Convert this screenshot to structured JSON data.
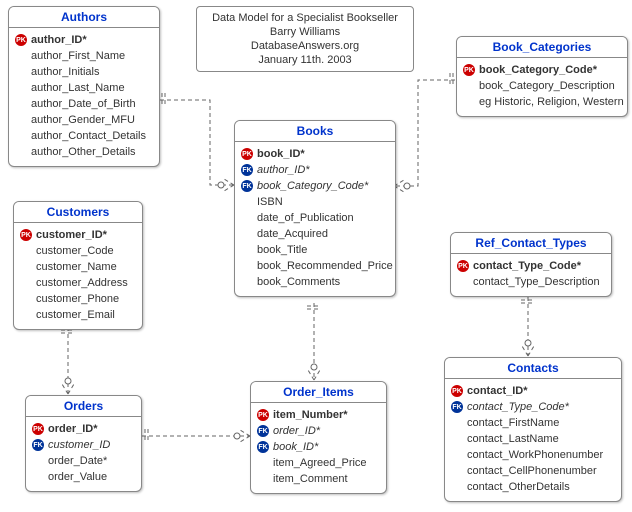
{
  "note": {
    "line1": "Data Model for a Specialist Bookseller",
    "line2": "Barry Williams",
    "line3": "DatabaseAnswers.org",
    "line4": "January 11th. 2003"
  },
  "entities": {
    "authors": {
      "title": "Authors",
      "attrs": [
        {
          "key": "PK",
          "name": "author_ID*",
          "keyname": true
        },
        {
          "key": "",
          "name": "author_First_Name"
        },
        {
          "key": "",
          "name": "author_Initials"
        },
        {
          "key": "",
          "name": "author_Last_Name"
        },
        {
          "key": "",
          "name": "author_Date_of_Birth"
        },
        {
          "key": "",
          "name": "author_Gender_MFU"
        },
        {
          "key": "",
          "name": "author_Contact_Details"
        },
        {
          "key": "",
          "name": "author_Other_Details"
        }
      ]
    },
    "book_categories": {
      "title": "Book_Categories",
      "attrs": [
        {
          "key": "PK",
          "name": "book_Category_Code*",
          "keyname": true
        },
        {
          "key": "",
          "name": "book_Category_Description"
        },
        {
          "key": "",
          "name": "eg Historic, Religion, Western"
        }
      ]
    },
    "books": {
      "title": "Books",
      "attrs": [
        {
          "key": "PK",
          "name": "book_ID*",
          "keyname": true
        },
        {
          "key": "FK",
          "name": "author_ID*",
          "fkname": true
        },
        {
          "key": "FK",
          "name": "book_Category_Code*",
          "fkname": true
        },
        {
          "key": "",
          "name": "ISBN"
        },
        {
          "key": "",
          "name": "date_of_Publication"
        },
        {
          "key": "",
          "name": "date_Acquired"
        },
        {
          "key": "",
          "name": "book_Title"
        },
        {
          "key": "",
          "name": "book_Recommended_Price"
        },
        {
          "key": "",
          "name": "book_Comments"
        }
      ]
    },
    "customers": {
      "title": "Customers",
      "attrs": [
        {
          "key": "PK",
          "name": "customer_ID*",
          "keyname": true
        },
        {
          "key": "",
          "name": "customer_Code"
        },
        {
          "key": "",
          "name": "customer_Name"
        },
        {
          "key": "",
          "name": "customer_Address"
        },
        {
          "key": "",
          "name": "customer_Phone"
        },
        {
          "key": "",
          "name": "customer_Email"
        }
      ]
    },
    "ref_contact_types": {
      "title": "Ref_Contact_Types",
      "attrs": [
        {
          "key": "PK",
          "name": "contact_Type_Code*",
          "keyname": true
        },
        {
          "key": "",
          "name": "contact_Type_Description"
        }
      ]
    },
    "orders": {
      "title": "Orders",
      "attrs": [
        {
          "key": "PK",
          "name": "order_ID*",
          "keyname": true
        },
        {
          "key": "FK",
          "name": "customer_ID",
          "fkname": true
        },
        {
          "key": "",
          "name": "order_Date*"
        },
        {
          "key": "",
          "name": "order_Value"
        }
      ]
    },
    "order_items": {
      "title": "Order_Items",
      "attrs": [
        {
          "key": "PK",
          "name": "item_Number*",
          "keyname": true
        },
        {
          "key": "FK",
          "name": "order_ID*",
          "fkname": true
        },
        {
          "key": "FK",
          "name": "book_ID*",
          "fkname": true
        },
        {
          "key": "",
          "name": "item_Agreed_Price"
        },
        {
          "key": "",
          "name": "item_Comment"
        }
      ]
    },
    "contacts": {
      "title": "Contacts",
      "attrs": [
        {
          "key": "PK",
          "name": "contact_ID*",
          "keyname": true
        },
        {
          "key": "FK",
          "name": "contact_Type_Code*",
          "fkname": true
        },
        {
          "key": "",
          "name": "contact_FirstName"
        },
        {
          "key": "",
          "name": "contact_LastName"
        },
        {
          "key": "",
          "name": "contact_WorkPhonenumber"
        },
        {
          "key": "",
          "name": "contact_CellPhonenumber"
        },
        {
          "key": "",
          "name": "contact_OtherDetails"
        }
      ]
    }
  },
  "key_labels": {
    "PK": "PK",
    "FK": "FK"
  }
}
